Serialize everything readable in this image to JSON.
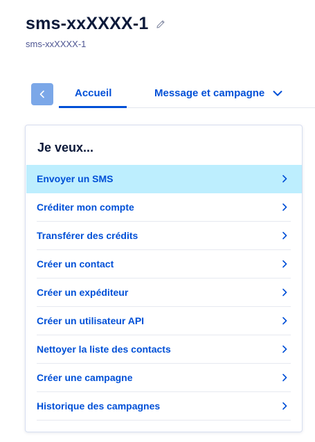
{
  "header": {
    "title": "sms-xxXXXX-1",
    "subtitle": "sms-xxXXXX-1"
  },
  "tabs": {
    "home": "Accueil",
    "campaign": "Message et campagne"
  },
  "card": {
    "title": "Je veux...",
    "actions": [
      {
        "label": "Envoyer un SMS"
      },
      {
        "label": "Créditer mon compte"
      },
      {
        "label": "Transférer des crédits"
      },
      {
        "label": "Créer un contact"
      },
      {
        "label": "Créer un expéditeur"
      },
      {
        "label": "Créer un utilisateur API"
      },
      {
        "label": "Nettoyer la liste des contacts"
      },
      {
        "label": "Créer une campagne"
      },
      {
        "label": "Historique des campagnes"
      }
    ]
  },
  "icons": {
    "edit": "pencil-icon",
    "back": "chevron-left-icon",
    "dropdown": "chevron-down-icon",
    "row": "chevron-right-icon"
  },
  "colors": {
    "accent": "#0050d7",
    "highlight": "#bdeefe",
    "back_button": "#7ba7e8",
    "title": "#0d1a3a"
  }
}
